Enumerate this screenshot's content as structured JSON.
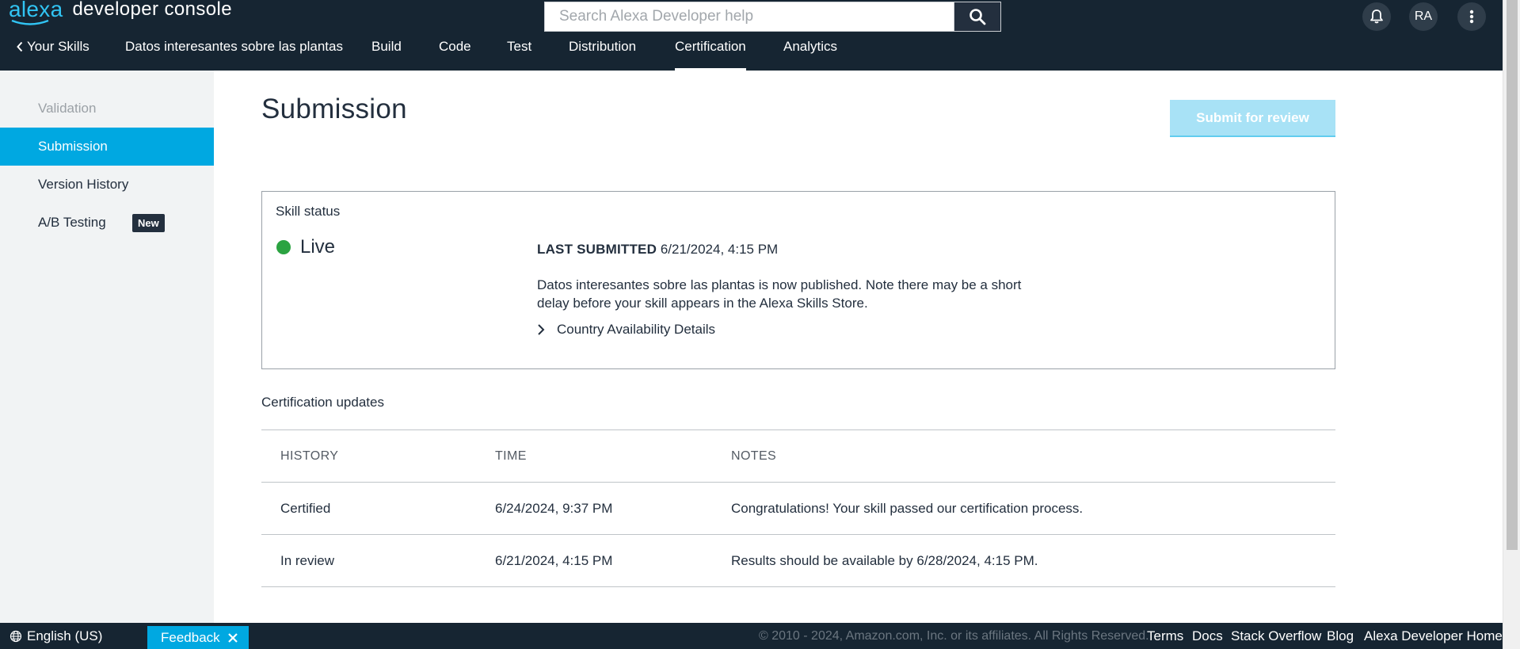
{
  "header": {
    "brand_alexa": "alexa",
    "brand_console": "developer console",
    "search_placeholder": "Search Alexa Developer help",
    "avatar_initials": "RA"
  },
  "nav": {
    "back_label": "Your Skills",
    "skill_name": "Datos interesantes sobre las plantas",
    "tabs": [
      {
        "label": "Build"
      },
      {
        "label": "Code"
      },
      {
        "label": "Test"
      },
      {
        "label": "Distribution"
      },
      {
        "label": "Certification",
        "active": true
      },
      {
        "label": "Analytics"
      }
    ]
  },
  "sidebar": {
    "items": [
      {
        "label": "Validation",
        "state": "disabled"
      },
      {
        "label": "Submission",
        "state": "active"
      },
      {
        "label": "Version History"
      },
      {
        "label": "A/B Testing",
        "badge": "New"
      }
    ]
  },
  "main": {
    "title": "Submission",
    "submit_button": "Submit for review",
    "skill_status": {
      "heading": "Skill status",
      "status": "Live",
      "status_color": "#2ba341",
      "last_submitted_label": "LAST SUBMITTED",
      "last_submitted_value": "6/21/2024, 4:15 PM",
      "message": "Datos interesantes sobre las plantas is now published. Note there may be a short delay before your skill appears in the Alexa Skills Store.",
      "country_link": "Country Availability Details"
    },
    "certification": {
      "heading": "Certification updates",
      "columns": [
        "HISTORY",
        "TIME",
        "NOTES"
      ],
      "rows": [
        {
          "history": "Certified",
          "time": "6/24/2024, 9:37 PM",
          "notes": "Congratulations! Your skill passed our certification process."
        },
        {
          "history": "In review",
          "time": "6/21/2024, 4:15 PM",
          "notes": "Results should be available by 6/28/2024, 4:15 PM."
        }
      ]
    }
  },
  "footer": {
    "language": "English (US)",
    "feedback": "Feedback",
    "copyright": "© 2010 - 2024, Amazon.com, Inc. or its affiliates. All Rights Reserved.",
    "links": [
      "Terms",
      "Docs",
      "Stack Overflow",
      "Blog",
      "Alexa Developer Home"
    ]
  },
  "colors": {
    "topbar": "#162532",
    "accent": "#00a8e1",
    "submit_disabled": "#a8e2f6",
    "sidebar_bg": "#f1f3f4"
  }
}
